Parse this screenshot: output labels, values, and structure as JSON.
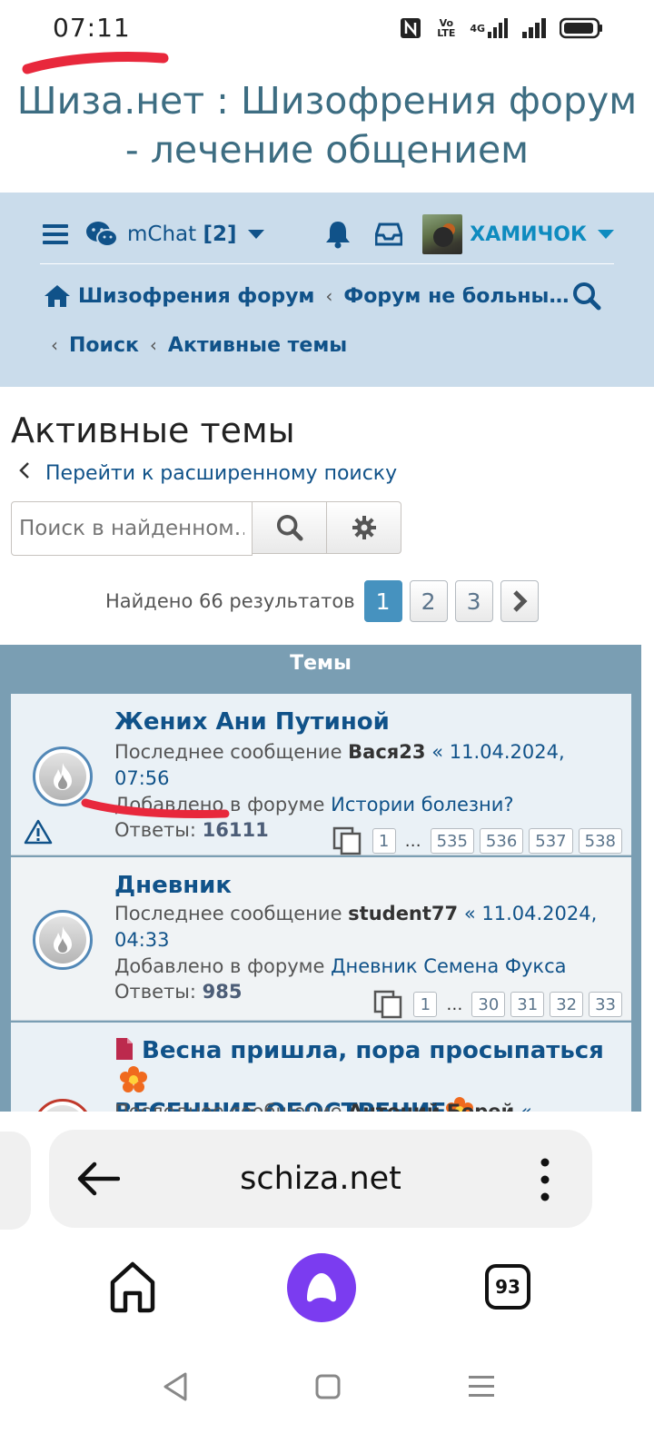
{
  "status": {
    "time": "07:11",
    "icons": [
      "nfc-icon",
      "volte-icon",
      "4g-signal-icon",
      "signal-icon",
      "battery-icon"
    ],
    "volte": "Vo LTE",
    "net": "4G"
  },
  "site": {
    "title_line1": "Шиза.нет : Шизофрения форум",
    "title_line2": "- лечение общением"
  },
  "nav": {
    "mchat_label": "mChat",
    "mchat_count": "[2]",
    "username": "ХАМИЧОК",
    "breadcrumb": [
      "Шизофрения форум",
      "Форум не больны…",
      "Поиск",
      "Активные темы"
    ]
  },
  "page": {
    "title": "Активные темы",
    "advanced_search": "Перейти к расширенному поиску",
    "search_placeholder": "Поиск в найденном…",
    "results": "Найдено 66 результатов",
    "pages": [
      "1",
      "2",
      "3"
    ],
    "active_page": "1"
  },
  "topics": {
    "header": "Темы",
    "last_post_label": "Последнее сообщение",
    "added_label": "Добавлено в форуме",
    "replies_label": "Ответы:",
    "rows": [
      {
        "title": "Жених Ани Путиной",
        "author": "Вася23",
        "date_part1": "« 11.04.2024,",
        "date_part2": "07:56",
        "forum": "Истории болезни?",
        "replies": "16111",
        "pages": [
          "1",
          "…",
          "535",
          "536",
          "537",
          "538"
        ]
      },
      {
        "title": "Дневник",
        "author": "student77",
        "date_part1": "« 11.04.2024,",
        "date_part2": "04:33",
        "forum": "Дневник Семена Фукса",
        "replies": "985",
        "pages": [
          "1",
          "…",
          "30",
          "31",
          "32",
          "33"
        ]
      },
      {
        "title_line1": "Весна пришла, пора просыпаться",
        "title_line2": "ВЕСЕННИЕ ОБОСТРЕНИЕ",
        "author": "Антоний Борей",
        "date_part1": "«"
      }
    ]
  },
  "browser": {
    "url": "schiza.net",
    "tab_count": "93"
  },
  "colors": {
    "link": "#105289",
    "nav_bg": "#cadceb",
    "topics_header": "#7a9eb3",
    "pager_active": "#4692bf",
    "alice": "#7b3cf0",
    "scribble": "#e8283c"
  }
}
